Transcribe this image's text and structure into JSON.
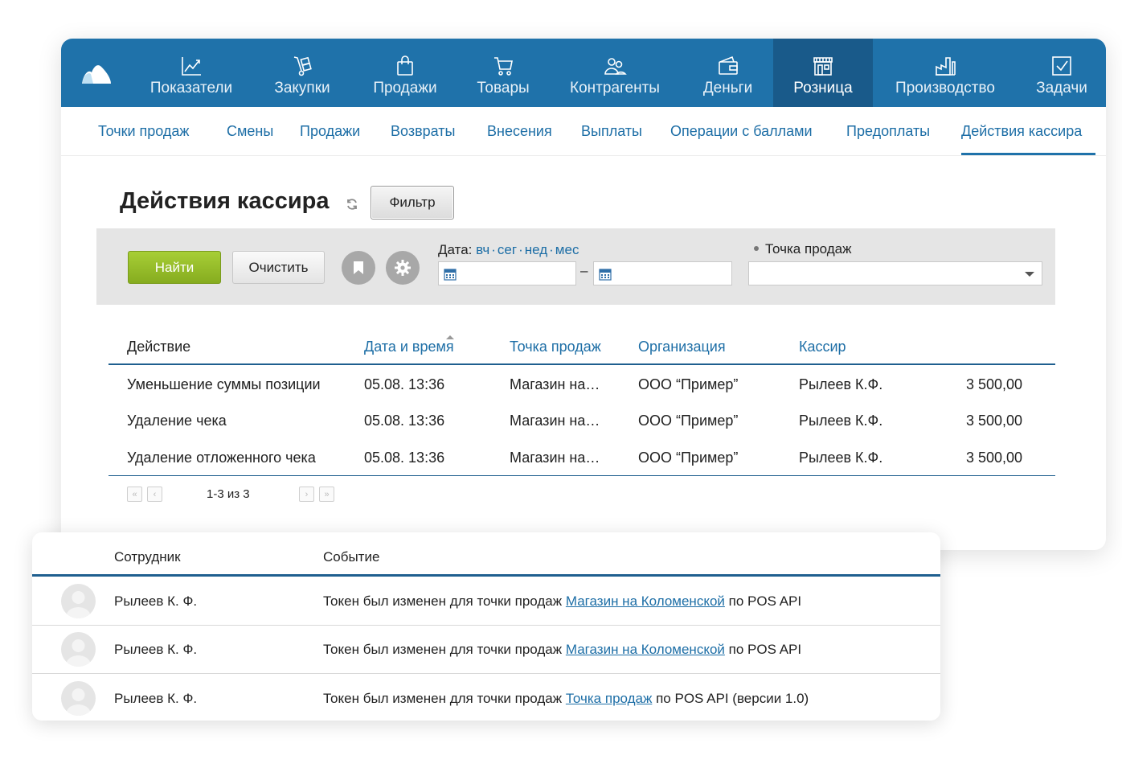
{
  "colors": {
    "nav_bg": "#1f72aa",
    "nav_active": "#195a8a",
    "link": "#1d6ea6",
    "find_button": "#95bd2a"
  },
  "nav": {
    "items": [
      {
        "label": "Показатели",
        "icon": "chart-line-icon"
      },
      {
        "label": "Закупки",
        "icon": "hand-truck-icon"
      },
      {
        "label": "Продажи",
        "icon": "shopping-bag-icon"
      },
      {
        "label": "Товары",
        "icon": "cart-icon"
      },
      {
        "label": "Контрагенты",
        "icon": "people-icon"
      },
      {
        "label": "Деньги",
        "icon": "wallet-icon"
      },
      {
        "label": "Розница",
        "icon": "store-icon",
        "active": true
      },
      {
        "label": "Производство",
        "icon": "factory-icon"
      },
      {
        "label": "Задачи",
        "icon": "checkbox-icon"
      }
    ]
  },
  "subnav": {
    "items": [
      "Точки продаж",
      "Смены",
      "Продажи",
      "Возвраты",
      "Внесения",
      "Выплаты",
      "Операции с баллами",
      "Предоплаты",
      "Действия кассира"
    ],
    "active": "Действия кассира"
  },
  "page": {
    "title": "Действия кассира",
    "filter_label": "Фильтр"
  },
  "filters": {
    "find_label": "Найти",
    "clear_label": "Очистить",
    "date_label": "Дата:",
    "date_shortcuts": [
      "вч",
      "сег",
      "нед",
      "мес"
    ],
    "date_separator": "–",
    "date_from": "",
    "date_to": "",
    "point_label": "Точка продаж",
    "point_value": ""
  },
  "table": {
    "headers": [
      "Действие",
      "Дата и время",
      "Точка продаж",
      "Организация",
      "Кассир"
    ],
    "rows": [
      {
        "action": "Уменьшение суммы позиции",
        "datetime": "05.08. 13:36",
        "point": "Магазин на…",
        "org": "ООО “Пример”",
        "cashier": "Рылеев К.Ф.",
        "amount": "3 500,00"
      },
      {
        "action": "Удаление чека",
        "datetime": "05.08. 13:36",
        "point": "Магазин на…",
        "org": "ООО “Пример”",
        "cashier": "Рылеев К.Ф.",
        "amount": "3 500,00"
      },
      {
        "action": "Удаление отложенного чека",
        "datetime": "05.08. 13:36",
        "point": "Магазин на…",
        "org": "ООО “Пример”",
        "cashier": "Рылеев К.Ф.",
        "amount": "3 500,00"
      }
    ]
  },
  "pager": {
    "text": "1-3 из 3",
    "first": "«",
    "prev": "‹",
    "next": "›",
    "last": "»"
  },
  "log": {
    "headers": [
      "Сотрудник",
      "Событие"
    ],
    "rows": [
      {
        "employee": "Рылеев К. Ф.",
        "prefix": "Токен был изменен для точки продаж",
        "link": "Магазин на Коломенской",
        "suffix": "по POS API"
      },
      {
        "employee": "Рылеев К. Ф.",
        "prefix": "Токен был изменен для точки продаж",
        "link": "Магазин на Коломенской",
        "suffix": "по POS API"
      },
      {
        "employee": "Рылеев К. Ф.",
        "prefix": "Токен был изменен для точки продаж",
        "link": "Точка продаж",
        "suffix": "по POS API (версии 1.0)"
      }
    ]
  }
}
